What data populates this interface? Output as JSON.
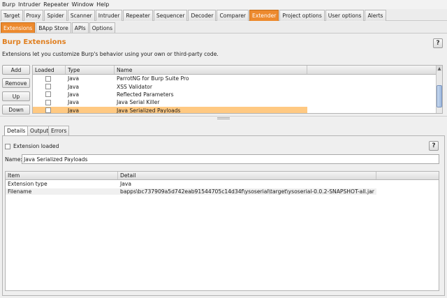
{
  "menu": [
    "Burp",
    "Intruder",
    "Repeater",
    "Window",
    "Help"
  ],
  "main_tabs": [
    {
      "label": "Target",
      "active": false
    },
    {
      "label": "Proxy",
      "active": false
    },
    {
      "label": "Spider",
      "active": false
    },
    {
      "label": "Scanner",
      "active": false
    },
    {
      "label": "Intruder",
      "active": false
    },
    {
      "label": "Repeater",
      "active": false
    },
    {
      "label": "Sequencer",
      "active": false
    },
    {
      "label": "Decoder",
      "active": false
    },
    {
      "label": "Comparer",
      "active": false
    },
    {
      "label": "Extender",
      "active": true
    },
    {
      "label": "Project options",
      "active": false
    },
    {
      "label": "User options",
      "active": false
    },
    {
      "label": "Alerts",
      "active": false
    }
  ],
  "sub_tabs": [
    {
      "label": "Extensions",
      "active": true
    },
    {
      "label": "BApp Store",
      "active": false
    },
    {
      "label": "APIs",
      "active": false
    },
    {
      "label": "Options",
      "active": false
    }
  ],
  "section": {
    "title": "Burp Extensions",
    "description": "Extensions let you customize Burp's behavior using your own or third-party code.",
    "help": "?"
  },
  "side_buttons": {
    "add": "Add",
    "remove": "Remove",
    "up": "Up",
    "down": "Down"
  },
  "extensions_table": {
    "headers": {
      "loaded": "Loaded",
      "type": "Type",
      "name": "Name"
    },
    "rows": [
      {
        "type": "Java",
        "name": "ParrotNG for Burp Suite Pro",
        "loaded": false
      },
      {
        "type": "Java",
        "name": "XSS Validator",
        "loaded": false
      },
      {
        "type": "Java",
        "name": "Reflected Parameters",
        "loaded": false
      },
      {
        "type": "Java",
        "name": "Java Serial Killer",
        "loaded": false
      },
      {
        "type": "Java",
        "name": "Java Serialized Payloads",
        "loaded": false,
        "selected": true
      }
    ]
  },
  "detail_tabs": [
    {
      "label": "Details",
      "active": true
    },
    {
      "label": "Output",
      "active": false
    },
    {
      "label": "Errors",
      "active": false
    }
  ],
  "details": {
    "extension_loaded_label": "Extension loaded",
    "help": "?",
    "name_label": "Name:",
    "name_value": "Java Serialized Payloads",
    "table_headers": {
      "item": "Item",
      "detail": "Detail"
    },
    "rows": [
      {
        "item": "Extension type",
        "detail": "Java"
      },
      {
        "item": "Filename",
        "detail": "bapps\\bc737909a5d742eab91544705c14d34f\\ysoserial\\target\\ysoserial-0.0.2-SNAPSHOT-all.jar"
      }
    ]
  },
  "colors": {
    "accent": "#ed8a2e",
    "title": "#e07f1f",
    "selected_row": "#ffc982"
  }
}
